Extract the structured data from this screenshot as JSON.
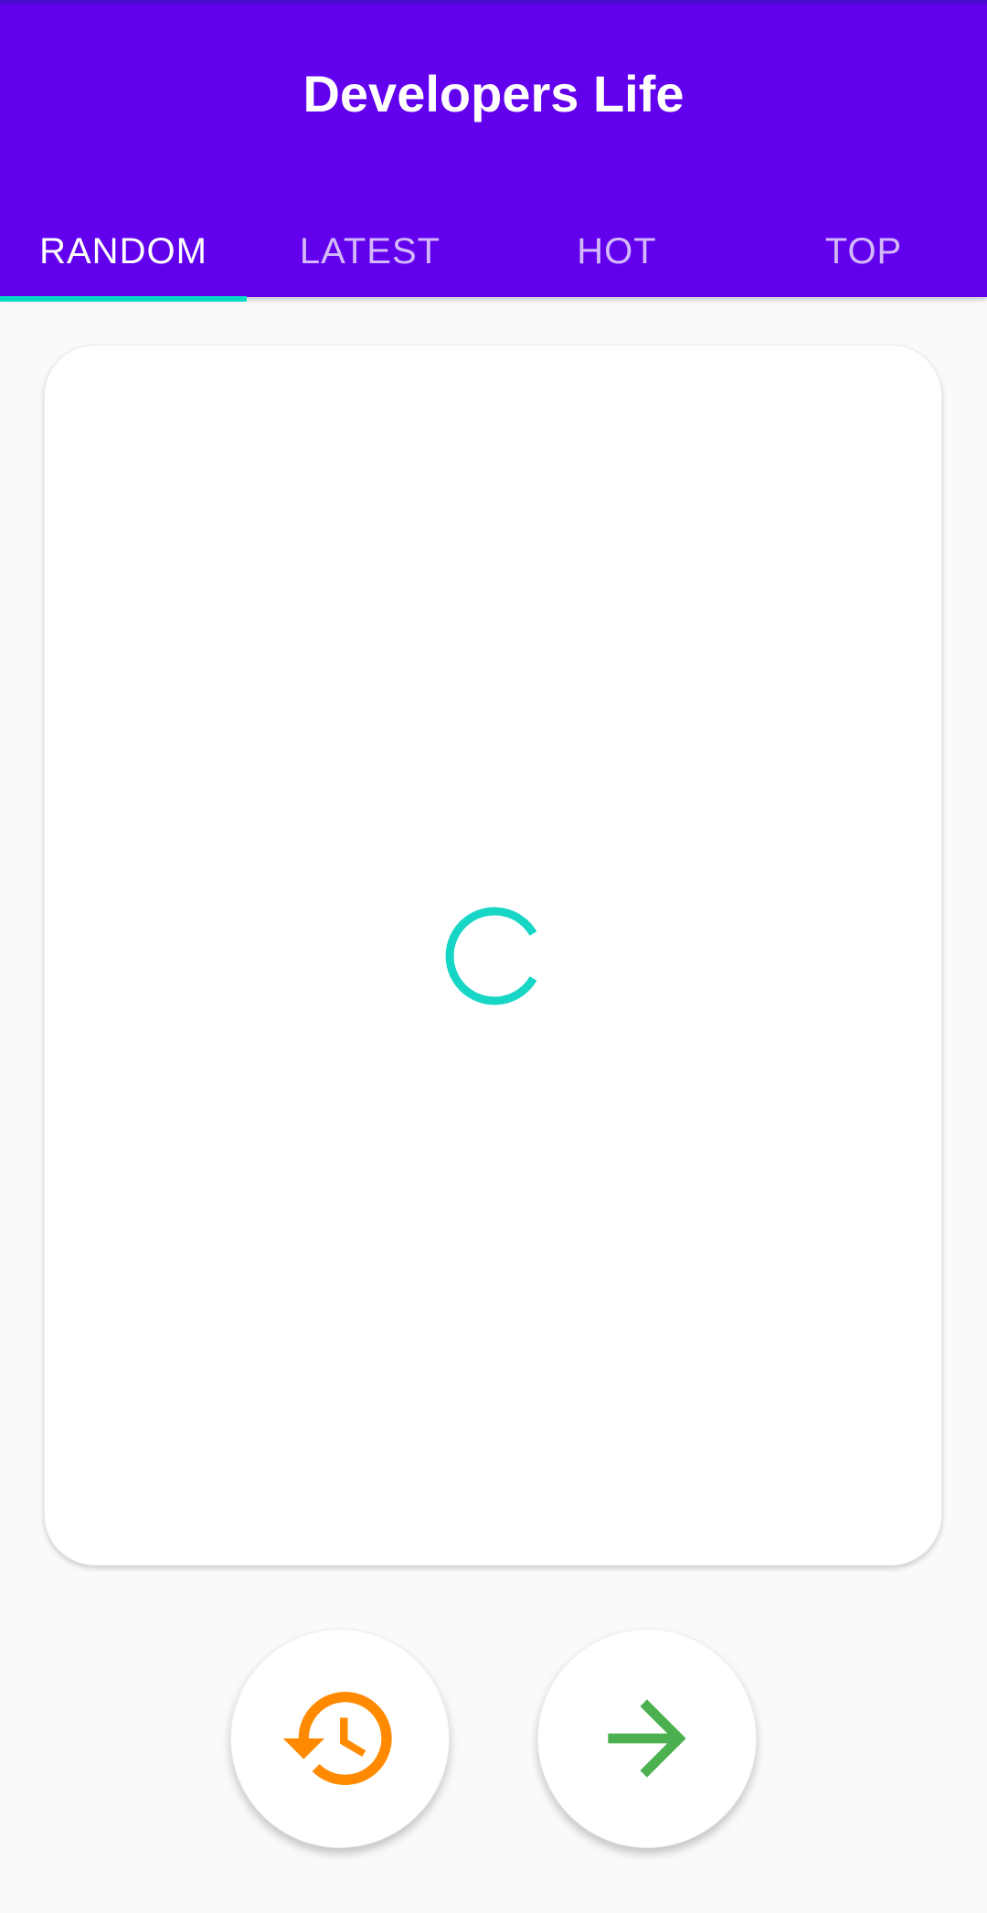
{
  "app_bar": {
    "title": "Developers Life",
    "background": "#6200ee"
  },
  "tabs": [
    {
      "label": "RANDOM",
      "selected": true
    },
    {
      "label": "LATEST",
      "selected": false
    },
    {
      "label": "HOT",
      "selected": false
    },
    {
      "label": "TOP",
      "selected": false
    }
  ],
  "indicator_color": "#03dac5",
  "card": {
    "loading": true,
    "spinner_icon": "progress-spinner-icon",
    "spinner_color": "#18d6c6"
  },
  "actions": {
    "back": {
      "icon": "history-icon",
      "color": "#ff8a00"
    },
    "next": {
      "icon": "arrow-forward-icon",
      "color": "#4caf50"
    }
  }
}
